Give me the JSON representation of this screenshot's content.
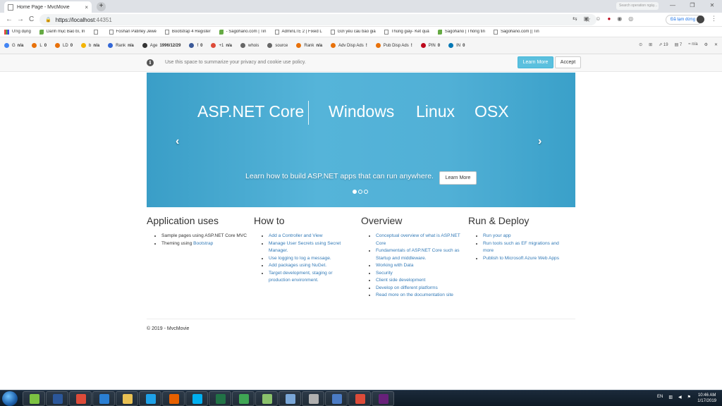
{
  "browser": {
    "tab_title": "Home Page - MvcMovie",
    "tab_close": "×",
    "new_tab": "+",
    "window_controls": [
      "—",
      "❐",
      "✕"
    ],
    "account_hint": "Search operation ngày...",
    "url_host": "https://localhost",
    "url_port": ":44351",
    "paused_label": "Đã tạm dừng",
    "nav": [
      "←",
      "→",
      "C"
    ]
  },
  "bookmarks": [
    {
      "label": "Ứng dụng",
      "icon": "apps"
    },
    {
      "label": "Danh mục Bao bì, In",
      "icon": "leaf"
    },
    {
      "label": "",
      "icon": "page"
    },
    {
      "label": "Foshan Patirley Jewe",
      "icon": "page"
    },
    {
      "label": "Bootstrap 4 Register",
      "icon": "page"
    },
    {
      "label": "- Sagohano.com | Tin",
      "icon": "leaf"
    },
    {
      "label": "AdminLTE 2 | Fixed L",
      "icon": "page"
    },
    {
      "label": "Gửi yêu cầu báo giá",
      "icon": "page"
    },
    {
      "label": "Thùng giấy- Kết quả",
      "icon": "page"
    },
    {
      "label": "Sagohano | Thông tin",
      "icon": "leaf"
    },
    {
      "label": "Sagohano.com || Tin",
      "icon": "page"
    }
  ],
  "seo_bar": [
    {
      "label": "G",
      "value": "n/a",
      "color": "#4285f4"
    },
    {
      "label": "L",
      "value": "0",
      "color": "#e8710a"
    },
    {
      "label": "LD",
      "value": "0",
      "color": "#e8710a"
    },
    {
      "label": "b",
      "value": "n/a",
      "color": "#f4b400"
    },
    {
      "label": "Rank",
      "value": "n/a",
      "color": "#3367d6"
    },
    {
      "label": "Age",
      "value": "1996/12/29",
      "color": "#333333"
    },
    {
      "label": "f",
      "value": "0",
      "color": "#3b5998"
    },
    {
      "label": "+1",
      "value": "n/a",
      "color": "#dd4b39"
    },
    {
      "label": "whois",
      "value": "",
      "color": "#666666"
    },
    {
      "label": "source",
      "value": "",
      "color": "#666666"
    },
    {
      "label": "Rank",
      "value": "n/a",
      "color": "#e8710a"
    },
    {
      "label": "Adv Disp Ads",
      "value": "!",
      "color": "#e8710a"
    },
    {
      "label": "Pub Disp Ads",
      "value": "!",
      "color": "#e8710a"
    },
    {
      "label": "PIN",
      "value": "0",
      "color": "#bd081c"
    },
    {
      "label": "IN",
      "value": "0",
      "color": "#0077b5"
    }
  ],
  "seo_right": [
    "⊙",
    "⊞",
    "⇗ 19",
    "▤ 7",
    "≈ n/a",
    "⚙",
    "✕"
  ],
  "cookie": {
    "info_icon": "i",
    "message": "Use this space to summarize your privacy and cookie use policy.",
    "learn_more": "Learn More",
    "accept": "Accept"
  },
  "carousel": {
    "title_1": "ASP.NET Core",
    "title_2": "Windows",
    "title_3": "Linux",
    "title_4": "OSX",
    "caption": "Learn how to build ASP.NET apps that can run anywhere.",
    "button": "Learn More",
    "prev": "‹",
    "next": "›",
    "slide_count": 3,
    "active_slide": 1
  },
  "columns": [
    {
      "heading": "Application uses",
      "items": [
        {
          "text": "Sample pages using ASP.NET Core MVC",
          "link": false
        },
        {
          "text": "Theming using ",
          "link": false,
          "link_text": "Bootstrap"
        }
      ]
    },
    {
      "heading": "How to",
      "items": [
        {
          "text": "Add a Controller and View",
          "link": true
        },
        {
          "text": "Manage User Secrets using Secret Manager.",
          "link": true
        },
        {
          "text": "Use logging to log a message.",
          "link": true
        },
        {
          "text": "Add packages using NuGet.",
          "link": true
        },
        {
          "text": "Target development, staging or production environment.",
          "link": true
        }
      ]
    },
    {
      "heading": "Overview",
      "items": [
        {
          "text": "Conceptual overview of what is ASP.NET Core",
          "link": true
        },
        {
          "text": "Fundamentals of ASP.NET Core such as Startup and middleware.",
          "link": true
        },
        {
          "text": "Working with Data",
          "link": true
        },
        {
          "text": "Security",
          "link": true
        },
        {
          "text": "Client side development",
          "link": true
        },
        {
          "text": "Develop on different platforms",
          "link": true
        },
        {
          "text": "Read more on the documentation site",
          "link": true
        }
      ]
    },
    {
      "heading": "Run & Deploy",
      "items": [
        {
          "text": "Run your app",
          "link": true
        },
        {
          "text": "Run tools such as EF migrations and more",
          "link": true
        },
        {
          "text": "Publish to Microsoft Azure Web Apps",
          "link": true
        }
      ]
    }
  ],
  "footer": "© 2019 - MvcMovie",
  "taskbar": {
    "items": [
      {
        "name": "winamp-icon",
        "color": "#7cc242"
      },
      {
        "name": "word-icon",
        "color": "#2b579a"
      },
      {
        "name": "chrome-icon",
        "color": "#dd4b39"
      },
      {
        "name": "app-icon",
        "color": "#2a7fd4"
      },
      {
        "name": "folder-icon",
        "color": "#e8c053"
      },
      {
        "name": "ie-icon",
        "color": "#1ea1e8"
      },
      {
        "name": "firefox-icon",
        "color": "#e66000"
      },
      {
        "name": "skype-icon",
        "color": "#00aff0"
      },
      {
        "name": "excel-icon",
        "color": "#217346"
      },
      {
        "name": "app-green-icon",
        "color": "#3fa654"
      },
      {
        "name": "notepad-icon",
        "color": "#8ac16b"
      },
      {
        "name": "app-blue-icon",
        "color": "#7aa7d8"
      },
      {
        "name": "tools-icon",
        "color": "#b0b0b0"
      },
      {
        "name": "remote-icon",
        "color": "#4b7bc4"
      },
      {
        "name": "chrome2-icon",
        "color": "#dd4b39"
      },
      {
        "name": "visual-studio-icon",
        "color": "#68217a"
      }
    ],
    "lang": "EN",
    "time": "10:46 AM",
    "date": "1/17/2019"
  }
}
